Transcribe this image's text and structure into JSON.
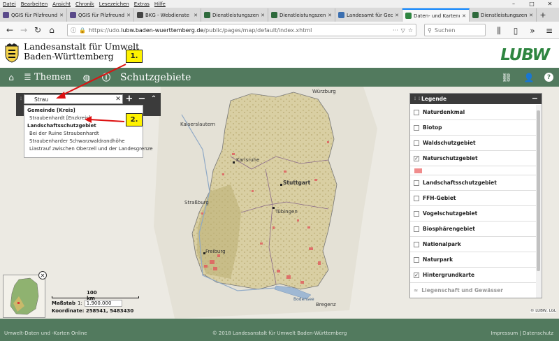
{
  "menu": [
    "Datei",
    "Bearbeiten",
    "Ansicht",
    "Chronik",
    "Lesezeichen",
    "Extras",
    "Hilfe"
  ],
  "window_controls": [
    "–",
    "□",
    "✕"
  ],
  "tabs": [
    {
      "label": "QGIS für Pilzfreunde",
      "favicon": "#5a4a8a"
    },
    {
      "label": "QGIS für Pilzfreunde",
      "favicon": "#5a4a8a"
    },
    {
      "label": "BKG - Webdienste",
      "favicon": "#444444"
    },
    {
      "label": "Dienstleistungszentr",
      "favicon": "#2e6a3c"
    },
    {
      "label": "Dienstleistungszentr",
      "favicon": "#2e6a3c"
    },
    {
      "label": "Landesamt für Geol",
      "favicon": "#3b6fb0"
    },
    {
      "label": "Daten- und Kartend",
      "favicon": "#2e8540",
      "active": true
    },
    {
      "label": "Dienstleistungszentr",
      "favicon": "#2e6a3c"
    }
  ],
  "url": {
    "prefix": "https://udo.",
    "domain": "lubw.baden-wuerttemberg.de",
    "rest": "/public/pages/map/default/index.xhtml"
  },
  "search_placeholder": "Suchen",
  "header": {
    "line1": "Landesanstalt für Umwelt",
    "line2": "Baden-Württemberg",
    "brand": "LUBW",
    "brand_color": "#2e8540"
  },
  "toolbar": {
    "themen": "Themen",
    "title": "Schutzgebiete"
  },
  "search": {
    "value": "Strau"
  },
  "results": [
    {
      "type": "group",
      "label": "Gemeinde [Kreis]"
    },
    {
      "type": "item",
      "label": "Straubenhardt [Enzkreis]"
    },
    {
      "type": "group",
      "label": "Landschaftsschutzgebiet"
    },
    {
      "type": "item",
      "label": "Bei der Ruine Straubenhardt"
    },
    {
      "type": "item",
      "label": "Straubenharder Schwarzwaldrandhöhe"
    },
    {
      "type": "item",
      "label": "Liastrauf zwischen Oberzell und der Landesgrenze"
    }
  ],
  "callouts": [
    "1.",
    "2."
  ],
  "legend": {
    "title": "Legende",
    "items": [
      {
        "label": "Naturdenkmal",
        "checked": false
      },
      {
        "label": "Biotop",
        "checked": false
      },
      {
        "label": "Waldschutzgebiet",
        "checked": false
      },
      {
        "label": "Naturschutzgebiet",
        "checked": true,
        "swatch": "#f08c8c"
      },
      {
        "label": "Landschaftsschutzgebiet",
        "checked": false
      },
      {
        "label": "FFH-Gebiet",
        "checked": false
      },
      {
        "label": "Vogelschutzgebiet",
        "checked": false
      },
      {
        "label": "Biosphärengebiet",
        "checked": false
      },
      {
        "label": "Nationalpark",
        "checked": false
      },
      {
        "label": "Naturpark",
        "checked": false
      },
      {
        "label": "Hintergrundkarte",
        "checked": true
      },
      {
        "label": "Liegenschaft und Gewässer",
        "checked": false,
        "faded": true
      }
    ]
  },
  "map_labels": {
    "wuerzburg": "Würzburg",
    "kaiserslautern": "Kaiserslautern",
    "karlsruhe": "Karlsruhe",
    "stuttgart": "Stuttgart",
    "strasbourg": "Straßburg",
    "tuebingen": "Tübingen",
    "freiburg": "Freiburg",
    "bodensee": "Bodensee",
    "bregenz": "Bregenz"
  },
  "scale": {
    "bar_label": "100 km",
    "massstab_label": "Maßstab",
    "massstab_prefix": "1:",
    "massstab_value": "1.900.000",
    "coords": "Koordinate: 258541, 5483430"
  },
  "copyright_map": "© LUBW, LGL",
  "footer": {
    "left": "Umwelt-Daten und -Karten Online",
    "center": "© 2018 Landesanstalt für Umwelt Baden-Württemberg",
    "right": "Impressum | Datenschutz"
  }
}
